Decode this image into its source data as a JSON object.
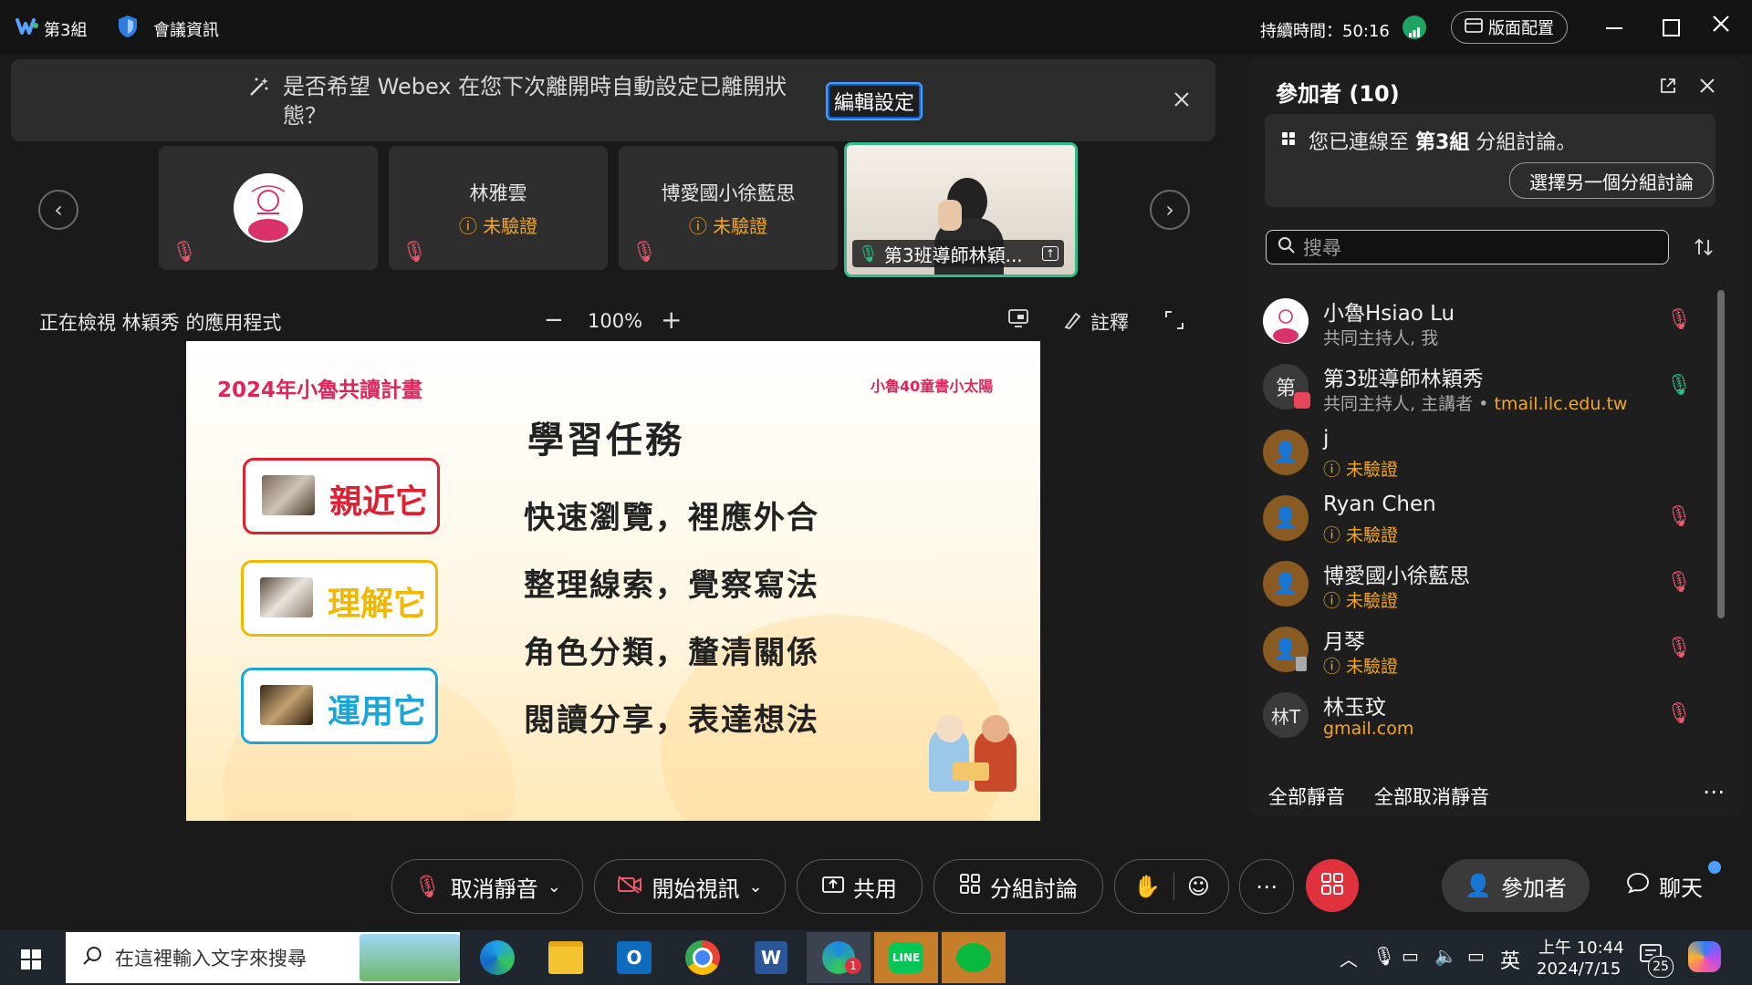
{
  "window": {
    "app_group": "第3組",
    "meeting_info_label": "會議資訊",
    "duration_label": "持續時間：50:16",
    "layout_label": "版面配置"
  },
  "banner": {
    "message_line1": "是否希望 Webex 在您下次離開時自動設定已離開狀",
    "message_line2": "態？",
    "edit_button": "編輯設定"
  },
  "tiles": [
    {
      "name": "",
      "status": ""
    },
    {
      "name": "林雅雲",
      "status": "未驗證"
    },
    {
      "name": "博愛國小徐藍思",
      "status": "未驗證"
    },
    {
      "name": "第3班導師林穎...",
      "status": ""
    }
  ],
  "content_header": {
    "viewing": "正在檢視 林穎秀 的應用程式",
    "zoom": "100%",
    "annotate": "註釋"
  },
  "slide": {
    "title_left": "2024年小魯共讀計畫",
    "brand_right": "小魯40童書小太陽",
    "heading": "學習任務",
    "cards": [
      "親近它",
      "理解它",
      "運用它"
    ],
    "tasks": [
      "快速瀏覽，裡應外合",
      "整理線索，覺察寫法",
      "角色分類，釐清關係",
      "閱讀分享，表達想法"
    ]
  },
  "panel": {
    "title": "參加者 (10)",
    "connected_prefix": "您已連線至",
    "connected_group": "第3組",
    "connected_suffix": "分組討論。",
    "choose_other": "選擇另一個分組討論",
    "search_placeholder": "搜尋",
    "participants": [
      {
        "name": "小魯Hsiao Lu",
        "sub": "共同主持人, 我"
      },
      {
        "name": "第3班導師林穎秀",
        "sub": "共同主持人, 主講者 •",
        "domain": "tmail.ilc.edu.tw",
        "initial": "第"
      },
      {
        "name": "j",
        "status": "未驗證"
      },
      {
        "name": "Ryan Chen",
        "status": "未驗證"
      },
      {
        "name": "博愛國小徐藍思",
        "status": "未驗證"
      },
      {
        "name": "月琴",
        "status": "未驗證"
      },
      {
        "name": "林玉玟",
        "domain": "gmail.com",
        "initial": "林T"
      }
    ],
    "mute_all": "全部靜音",
    "unmute_all": "全部取消靜音"
  },
  "controls": {
    "unmute": "取消靜音",
    "start_video": "開始視訊",
    "share": "共用",
    "breakout": "分組討論",
    "participants": "參加者",
    "chat": "聊天"
  },
  "taskbar": {
    "search_placeholder": "在這裡輸入文字來搜尋",
    "time": "上午 10:44",
    "date": "2024/7/15",
    "ime": "英",
    "notif_count": "25",
    "webex_badge": "1"
  }
}
